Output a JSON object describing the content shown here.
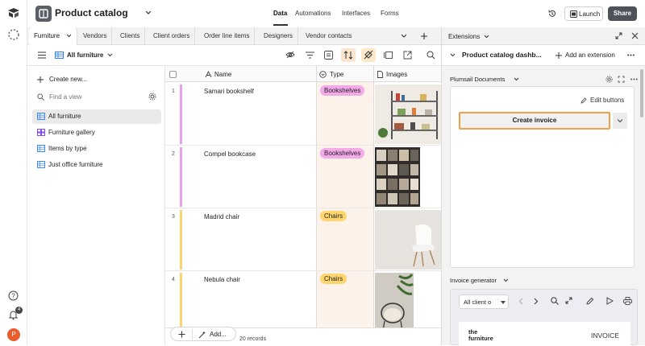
{
  "header": {
    "title": "Product catalog",
    "nav": [
      "Data",
      "Automations",
      "Interfaces",
      "Forms"
    ],
    "launch_label": "Launch",
    "share_label": "Share"
  },
  "rail": {
    "avatar_initial": "P",
    "notification_count": "4"
  },
  "tabs": [
    "Furniture",
    "Vendors",
    "Clients",
    "Client orders",
    "Order line items",
    "Designers",
    "Vendor contacts"
  ],
  "toolbar": {
    "view_name": "All furniture"
  },
  "sidebar": {
    "create_new": "Create new...",
    "find_placeholder": "Find a view",
    "views": [
      {
        "label": "All furniture",
        "icon": "grid-view-icon"
      },
      {
        "label": "Furniture gallery",
        "icon": "gallery-view-icon"
      },
      {
        "label": "Items by type",
        "icon": "grid-view-icon"
      },
      {
        "label": "Just office furniture",
        "icon": "grid-view-icon"
      }
    ]
  },
  "grid": {
    "columns": [
      "Name",
      "Type",
      "Images"
    ],
    "rows": [
      {
        "num": "1",
        "name": "Samari bookshelf",
        "type": "Bookshelves"
      },
      {
        "num": "2",
        "name": "Compel bookcase",
        "type": "Bookshelves"
      },
      {
        "num": "3",
        "name": "Madrid chair",
        "type": "Chairs"
      },
      {
        "num": "4",
        "name": "Nebula chair",
        "type": "Chairs"
      }
    ],
    "add_label": "Add...",
    "record_count": "20 records"
  },
  "extensions": {
    "header": "Extensions",
    "dashboard_title": "Product catalog dashb...",
    "add_extension": "Add an extension",
    "plumsail": {
      "title": "Plumsail Documents",
      "edit_buttons": "Edit buttons",
      "create_invoice": "Create invoice"
    },
    "invoice": {
      "title": "Invoice generator",
      "select_value": "All client o",
      "brand_line1": "the",
      "brand_line2": "furniture",
      "doc_label": "INVOICE"
    }
  },
  "colors": {
    "bookshelves_pill": "#f4a9e8",
    "chairs_pill": "#ffd66e",
    "bookshelves_bar": "#e9a1ec",
    "chairs_bar": "#fdd36b",
    "type_column_bg": "#fdf2ea",
    "accent_orange": "#f0a04b"
  }
}
